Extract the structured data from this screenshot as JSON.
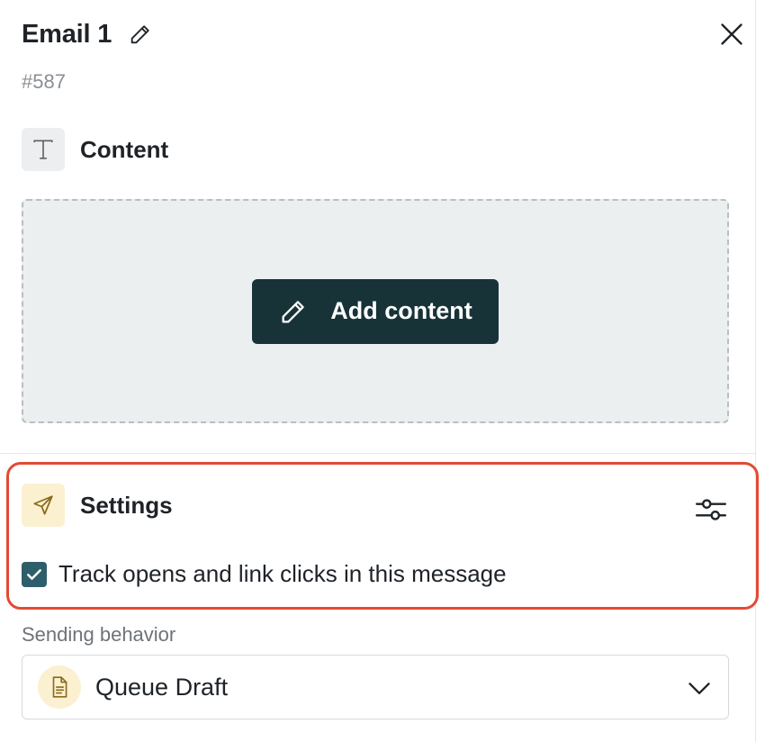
{
  "header": {
    "title": "Email 1",
    "edit_icon": "pencil-icon",
    "close_icon": "close-icon"
  },
  "id_label": "#587",
  "content_section": {
    "icon": "text-icon",
    "label": "Content",
    "add_button_icon": "pencil-icon",
    "add_button_label": "Add content"
  },
  "settings_section": {
    "icon": "send-icon",
    "label": "Settings",
    "toggle_icon": "sliders-icon",
    "track_checkbox_checked": true,
    "track_label": "Track opens and link clicks in this message"
  },
  "sending_behavior": {
    "label": "Sending behavior",
    "selected_icon": "document-icon",
    "selected_value": "Queue Draft",
    "dropdown_icon": "chevron-down-icon"
  },
  "colors": {
    "primary_button": "#173338",
    "checkbox": "#2e5e69",
    "highlight_border": "#e34a33",
    "settings_icon_bg": "#fbf0d0"
  }
}
